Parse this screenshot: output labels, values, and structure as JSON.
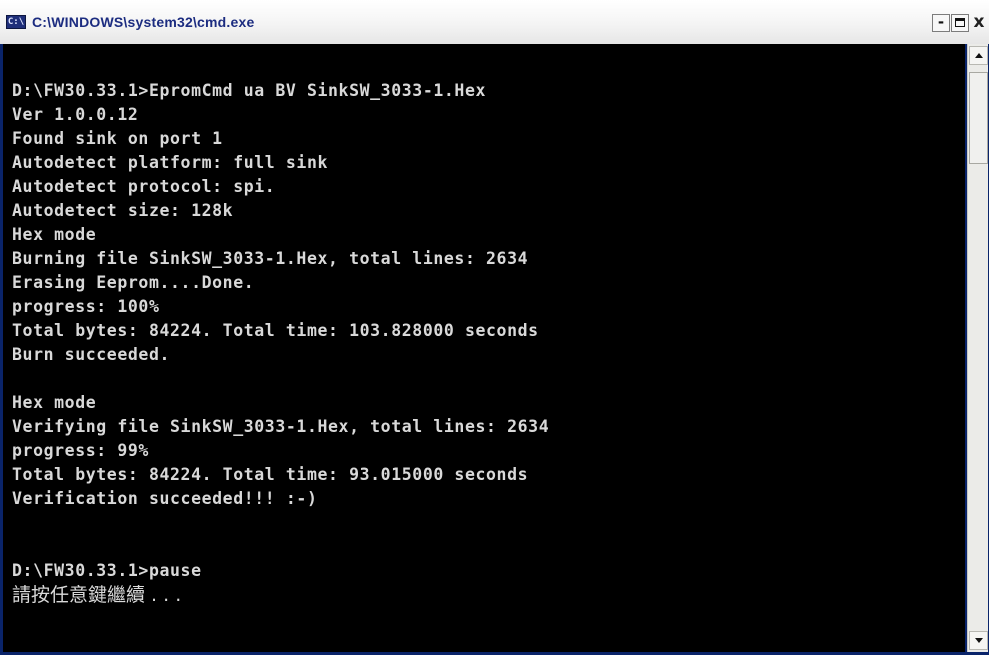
{
  "window": {
    "title": "C:\\WINDOWS\\system32\\cmd.exe",
    "icon_text": "C:\\",
    "controls": {
      "minimize": "-",
      "close": "x"
    }
  },
  "console": {
    "lines": [
      "D:\\FW30.33.1>EpromCmd ua BV SinkSW_3033-1.Hex",
      "Ver 1.0.0.12",
      "Found sink on port 1",
      "Autodetect platform: full sink",
      "Autodetect protocol: spi.",
      "Autodetect size: 128k",
      "Hex mode",
      "Burning file SinkSW_3033-1.Hex, total lines: 2634",
      "Erasing Eeprom....Done.",
      "progress: 100%",
      "Total bytes: 84224. Total time: 103.828000 seconds",
      "Burn succeeded.",
      "",
      "Hex mode",
      "Verifying file SinkSW_3033-1.Hex, total lines: 2634",
      "progress: 99%",
      "Total bytes: 84224. Total time: 93.015000 seconds",
      "Verification succeeded!!! :-)",
      "",
      "",
      "D:\\FW30.33.1>pause",
      "請按任意鍵繼續 . . ."
    ]
  },
  "colors": {
    "console_bg": "#000000",
    "console_text": "#d9d9d9",
    "title_text": "#1c2c80"
  }
}
